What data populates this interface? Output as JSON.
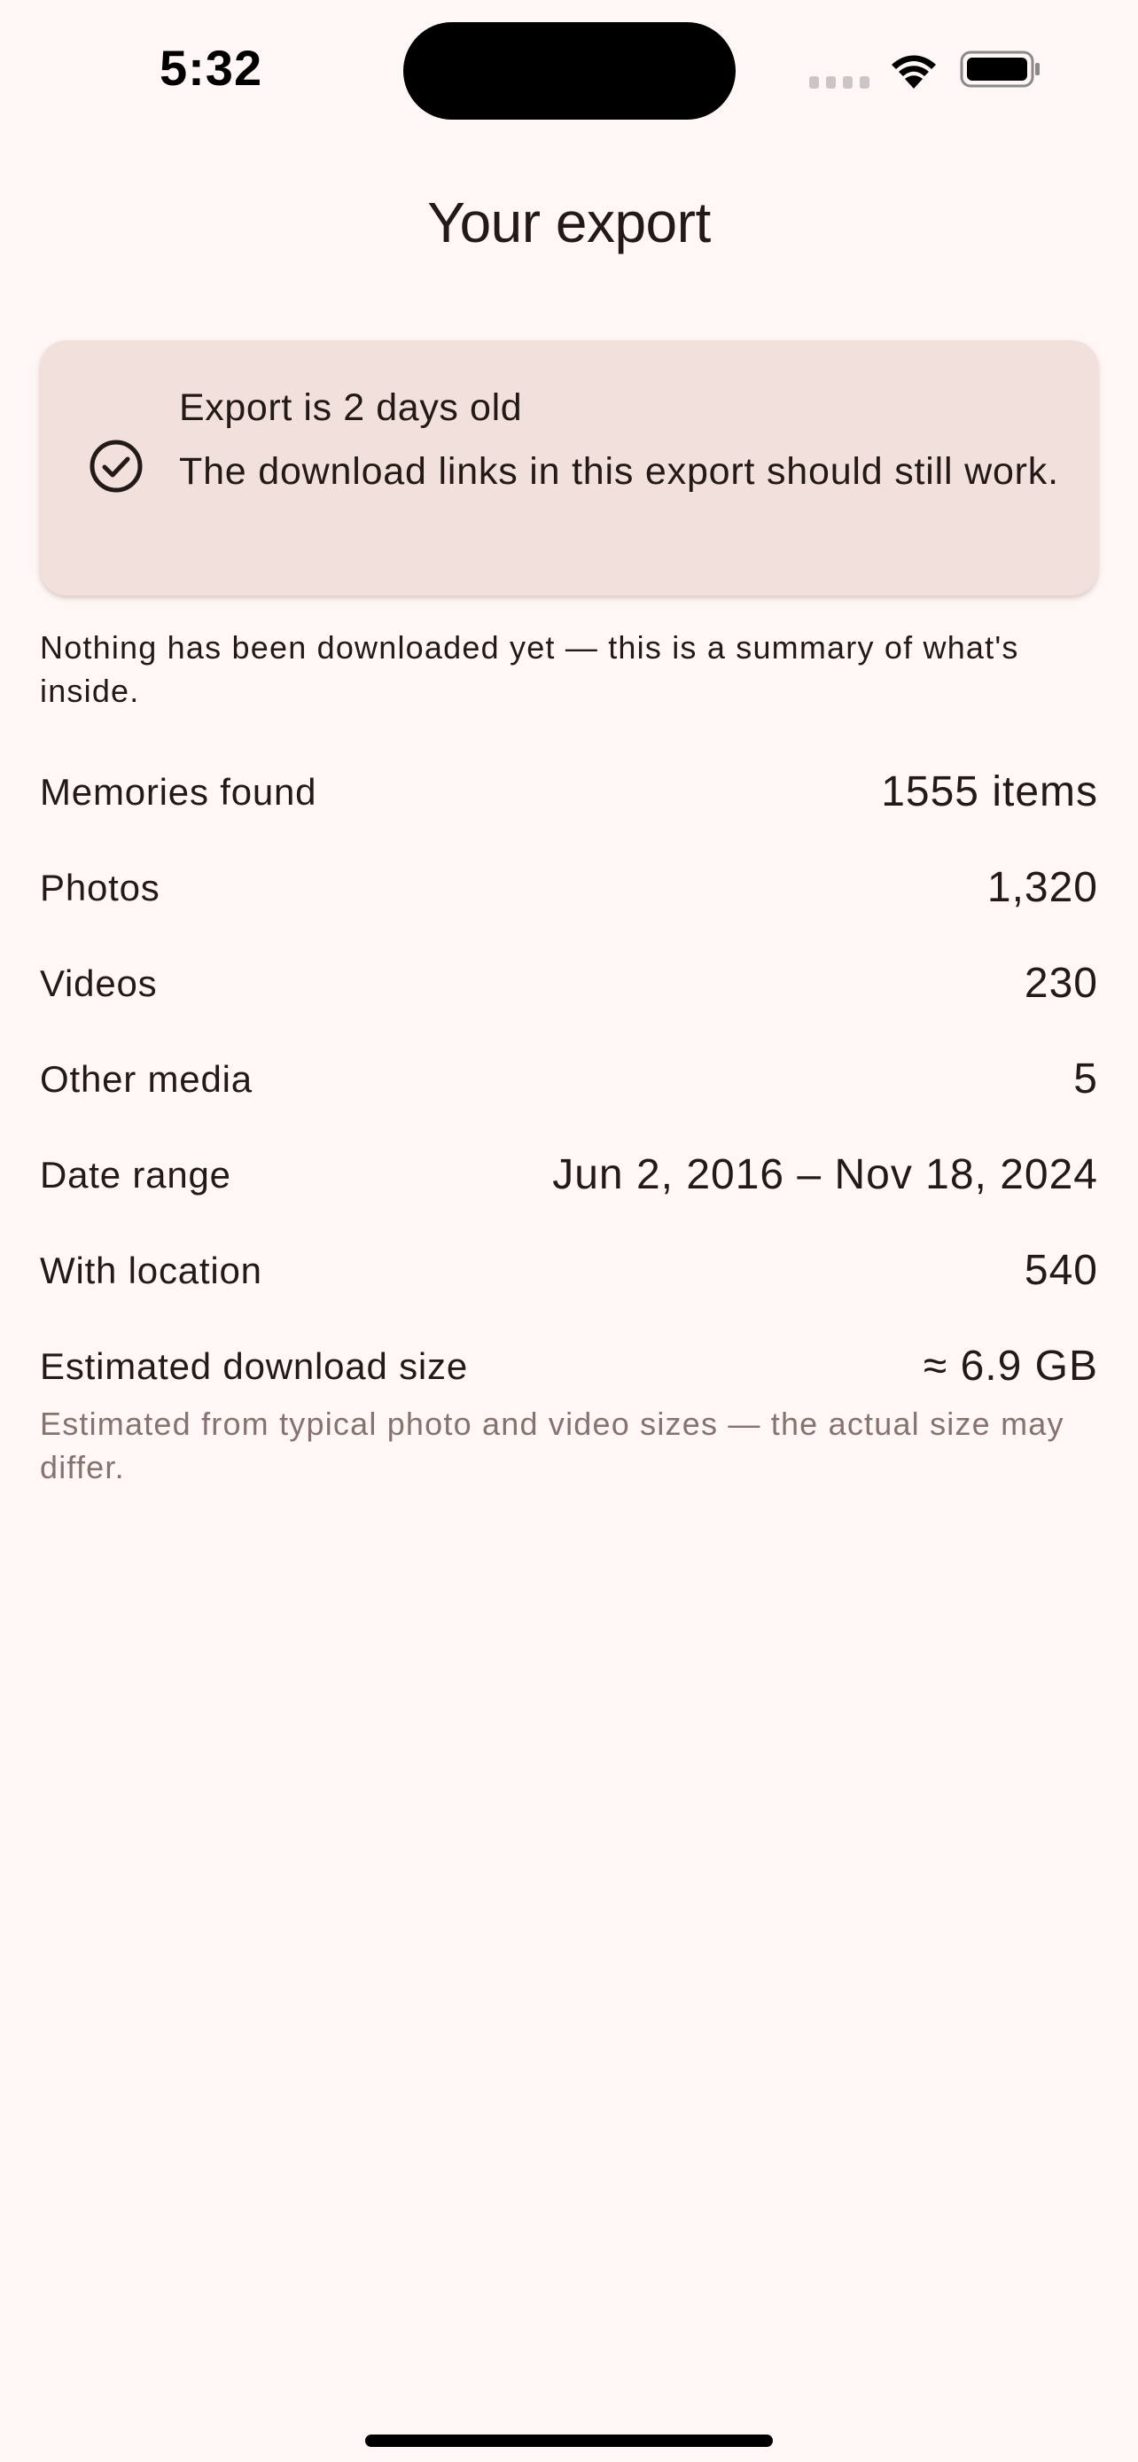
{
  "status_bar": {
    "time": "5:32",
    "icons": [
      "cellular-signal-icon",
      "wifi-icon",
      "battery-icon"
    ]
  },
  "header": {
    "title": "Your export"
  },
  "info_card": {
    "icon": "check-circle-icon",
    "title": "Export is 2 days old",
    "body": "The download links in this export should still work."
  },
  "summary_note": "Nothing has been downloaded yet — this is a summary of what's inside.",
  "stats": [
    {
      "label": "Memories found",
      "value": "1555 items"
    },
    {
      "label": "Photos",
      "value": "1,320"
    },
    {
      "label": "Videos",
      "value": "230"
    },
    {
      "label": "Other media",
      "value": "5"
    },
    {
      "label": "Date range",
      "value": "Jun 2, 2016 – Nov 18, 2024"
    },
    {
      "label": "With location",
      "value": "540"
    },
    {
      "label": "Estimated download size",
      "value": "≈ 6.9 GB"
    }
  ],
  "estimate_note": "Estimated from typical photo and video sizes — the actual size may differ.",
  "colors": {
    "background": "#fff7f5",
    "card": "#f1e0db",
    "text": "#231a18",
    "muted_text": "#857370"
  }
}
